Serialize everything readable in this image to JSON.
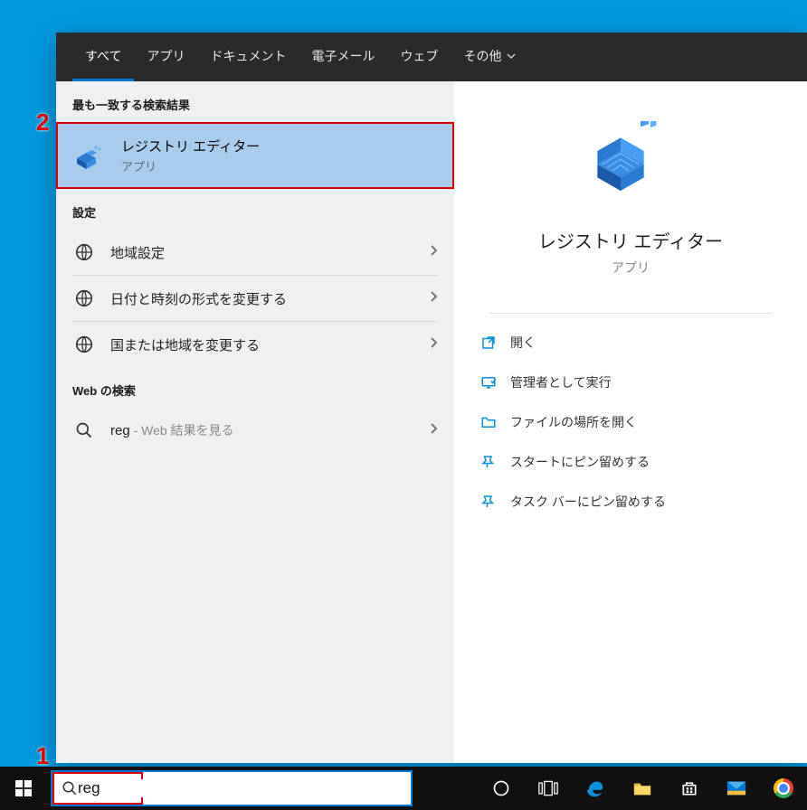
{
  "tabs": {
    "all": "すべて",
    "apps": "アプリ",
    "documents": "ドキュメント",
    "email": "電子メール",
    "web": "ウェブ",
    "more": "その他"
  },
  "sections": {
    "best_match": "最も一致する検索結果",
    "settings": "設定",
    "web_search": "Web の検索"
  },
  "best_match": {
    "title": "レジストリ エディター",
    "subtitle": "アプリ"
  },
  "settings_items": [
    "地域設定",
    "日付と時刻の形式を変更する",
    "国または地域を変更する"
  ],
  "web_item": {
    "term": "reg",
    "suffix": " - Web 結果を見る"
  },
  "detail": {
    "title": "レジストリ エディター",
    "subtitle": "アプリ"
  },
  "actions": [
    "開く",
    "管理者として実行",
    "ファイルの場所を開く",
    "スタートにピン留めする",
    "タスク バーにピン留めする"
  ],
  "search": {
    "value": "reg"
  },
  "callouts": {
    "one": "1",
    "two": "2"
  }
}
